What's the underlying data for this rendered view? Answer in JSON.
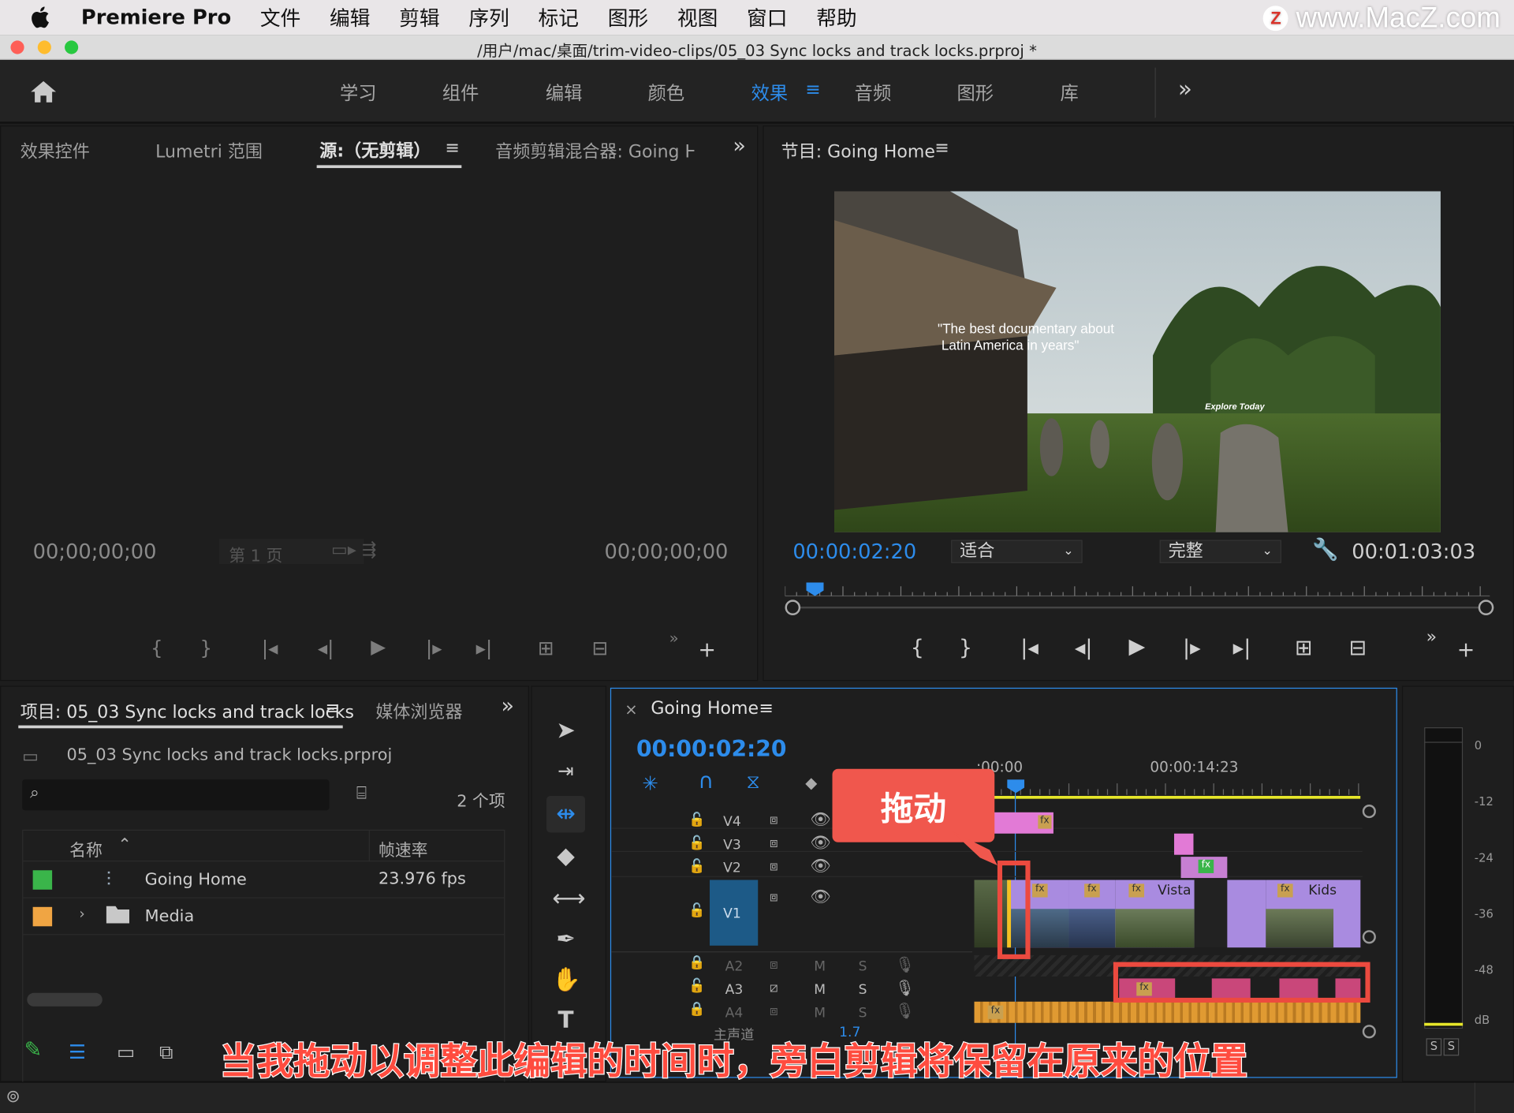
{
  "menubar": {
    "app_name": "Premiere Pro",
    "items": [
      "文件",
      "编辑",
      "剪辑",
      "序列",
      "标记",
      "图形",
      "视图",
      "窗口",
      "帮助"
    ]
  },
  "watermark": {
    "badge": "Z",
    "text": "www.MacZ.com"
  },
  "window": {
    "title": "/用户/mac/桌面/trim-video-clips/05_03 Sync locks and track locks.prproj *"
  },
  "workspaces": {
    "items": [
      "学习",
      "组件",
      "编辑",
      "颜色",
      "效果",
      "音频",
      "图形",
      "库"
    ],
    "active": "效果",
    "more": "»"
  },
  "source_panel": {
    "tabs": [
      "效果控件",
      "Lumetri 范围",
      "源:（无剪辑）",
      "音频剪辑混合器: Going H"
    ],
    "menu_icon": "≡",
    "more": "»",
    "timecode_in": "00;00;00;00",
    "timecode_out": "00;00;00;00",
    "page_label": "第 1 页"
  },
  "program_panel": {
    "title": "节目: Going Home",
    "menu_icon": "≡",
    "overlay_text_line1": "\"The best documentary about",
    "overlay_text_line2": "Latin America in years\"",
    "overlay_brand": "Explore Today",
    "timecode": "00:00:02:20",
    "fit_select": "适合",
    "quality_select": "完整",
    "duration": "00:01:03:03",
    "more": "»",
    "plus": "+"
  },
  "project_panel": {
    "title": "项目: 05_03 Sync locks and track locks",
    "menu_icon": "≡",
    "tab_media_browser": "媒体浏览器",
    "more": "»",
    "file_name": "05_03 Sync locks and track locks.prproj",
    "item_count": "2 个项",
    "search_placeholder": "",
    "columns": {
      "name": "名称",
      "fps": "帧速率"
    },
    "rows": [
      {
        "name": "Going Home",
        "fps": "23.976 fps",
        "color": "#3ab54a"
      },
      {
        "name": "Media",
        "fps": "",
        "color": "#f0a543"
      }
    ]
  },
  "timeline": {
    "close": "×",
    "sequence_name": "Going Home",
    "menu_icon": "≡",
    "timecode": "00:00:02:20",
    "ruler_start": ":00:00",
    "ruler_mark": "00:00:14:23",
    "video_tracks": [
      "V4",
      "V3",
      "V2",
      "V1"
    ],
    "audio_tracks": [
      "A2",
      "A3",
      "A4"
    ],
    "mute_label": "M",
    "solo_label": "S",
    "master_label": "主声道",
    "master_value": "1.7",
    "clip_labels": {
      "vista": "Vista",
      "kids": "Kids",
      "fx": "fx"
    }
  },
  "audio_meter": {
    "scale": [
      "0",
      "-12",
      "-24",
      "-36",
      "-48",
      "dB"
    ],
    "solo_buttons": [
      "S",
      "S"
    ]
  },
  "annotation": {
    "callout": "拖动",
    "caption": "当我拖动以调整此编辑的时间时，旁白剪辑将保留在原来的位置"
  },
  "colors": {
    "accent_blue": "#2d8ceb",
    "callout_red": "#f0574d",
    "clip_purple": "#a98be0",
    "clip_pink": "#e27ad6",
    "audio_pink": "#c9477a",
    "audio_orange": "#e09a32"
  }
}
